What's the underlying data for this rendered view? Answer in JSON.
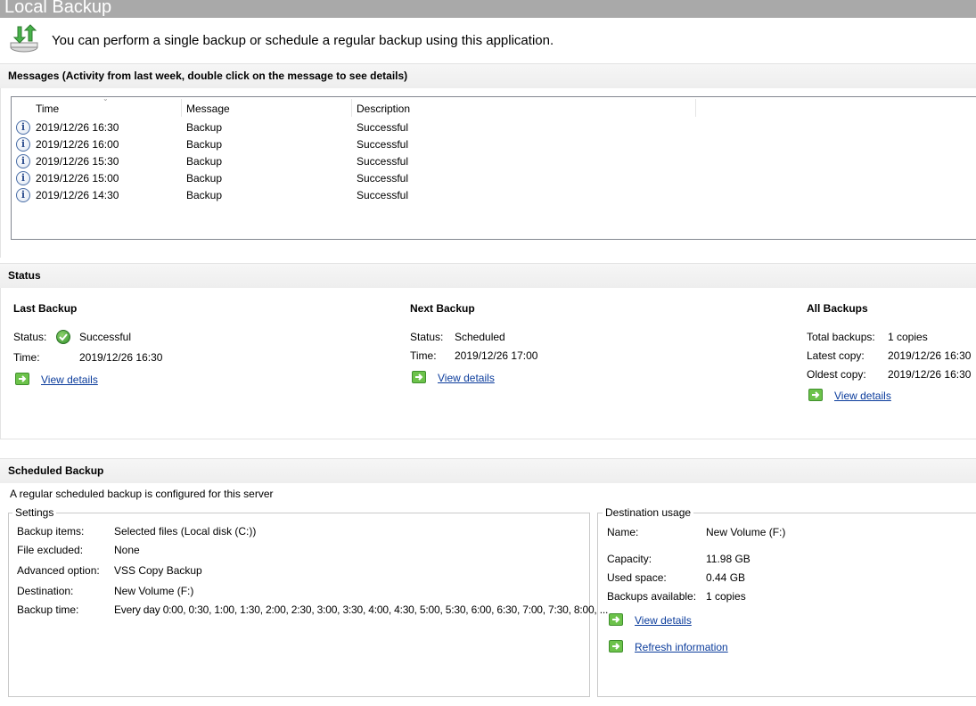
{
  "window": {
    "title": "Local Backup"
  },
  "intro": {
    "text": "You can perform a single backup or schedule a regular backup using this application."
  },
  "messages": {
    "header": "Messages (Activity from last week, double click on the message to see details)",
    "columns": [
      "Time",
      "Message",
      "Description"
    ],
    "rows": [
      {
        "icon": "info-icon",
        "time": "2019/12/26 16:30",
        "message": "Backup",
        "description": "Successful"
      },
      {
        "icon": "info-icon",
        "time": "2019/12/26 16:00",
        "message": "Backup",
        "description": "Successful"
      },
      {
        "icon": "info-icon",
        "time": "2019/12/26 15:30",
        "message": "Backup",
        "description": "Successful"
      },
      {
        "icon": "info-icon",
        "time": "2019/12/26 15:00",
        "message": "Backup",
        "description": "Successful"
      },
      {
        "icon": "info-icon",
        "time": "2019/12/26 14:30",
        "message": "Backup",
        "description": "Successful"
      }
    ]
  },
  "status": {
    "header": "Status",
    "last_backup": {
      "title": "Last Backup",
      "status_label": "Status:",
      "status_value": "Successful",
      "time_label": "Time:",
      "time_value": "2019/12/26 16:30",
      "link": "View details"
    },
    "next_backup": {
      "title": "Next Backup",
      "status_label": "Status:",
      "status_value": "Scheduled",
      "time_label": "Time:",
      "time_value": "2019/12/26 17:00",
      "link": "View details"
    },
    "all_backups": {
      "title": "All Backups",
      "total_label": "Total backups:",
      "total_value": "1 copies",
      "latest_label": "Latest copy:",
      "latest_value": "2019/12/26 16:30",
      "oldest_label": "Oldest copy:",
      "oldest_value": "2019/12/26 16:30",
      "link": "View details"
    }
  },
  "scheduled": {
    "header": "Scheduled Backup",
    "summary": "A regular scheduled backup is configured for this server",
    "settings": {
      "title": "Settings",
      "rows": [
        {
          "label": "Backup items:",
          "value": "Selected files (Local disk (C:))"
        },
        {
          "label": "File excluded:",
          "value": "None"
        },
        {
          "label": "Advanced option:",
          "value": "VSS Copy Backup"
        },
        {
          "label": "Destination:",
          "value": "New Volume (F:)"
        },
        {
          "label": "Backup time:",
          "value": "Every day 0:00, 0:30, 1:00, 1:30, 2:00, 2:30, 3:00, 3:30, 4:00, 4:30, 5:00, 5:30, 6:00, 6:30, 7:00, 7:30, 8:00, ..."
        }
      ]
    },
    "destination": {
      "title": "Destination usage",
      "name_label": "Name:",
      "name_value": "New Volume (F:)",
      "capacity_label": "Capacity:",
      "capacity_value": "11.98 GB",
      "used_label": "Used space:",
      "used_value": "0.44 GB",
      "available_label": "Backups available:",
      "available_value": "1 copies",
      "view_link": "View details",
      "refresh_link": "Refresh information"
    }
  },
  "colors": {
    "title_bar": "#a9a9a9",
    "link": "#0b3c9c",
    "success_green": "#2f8f2a"
  }
}
